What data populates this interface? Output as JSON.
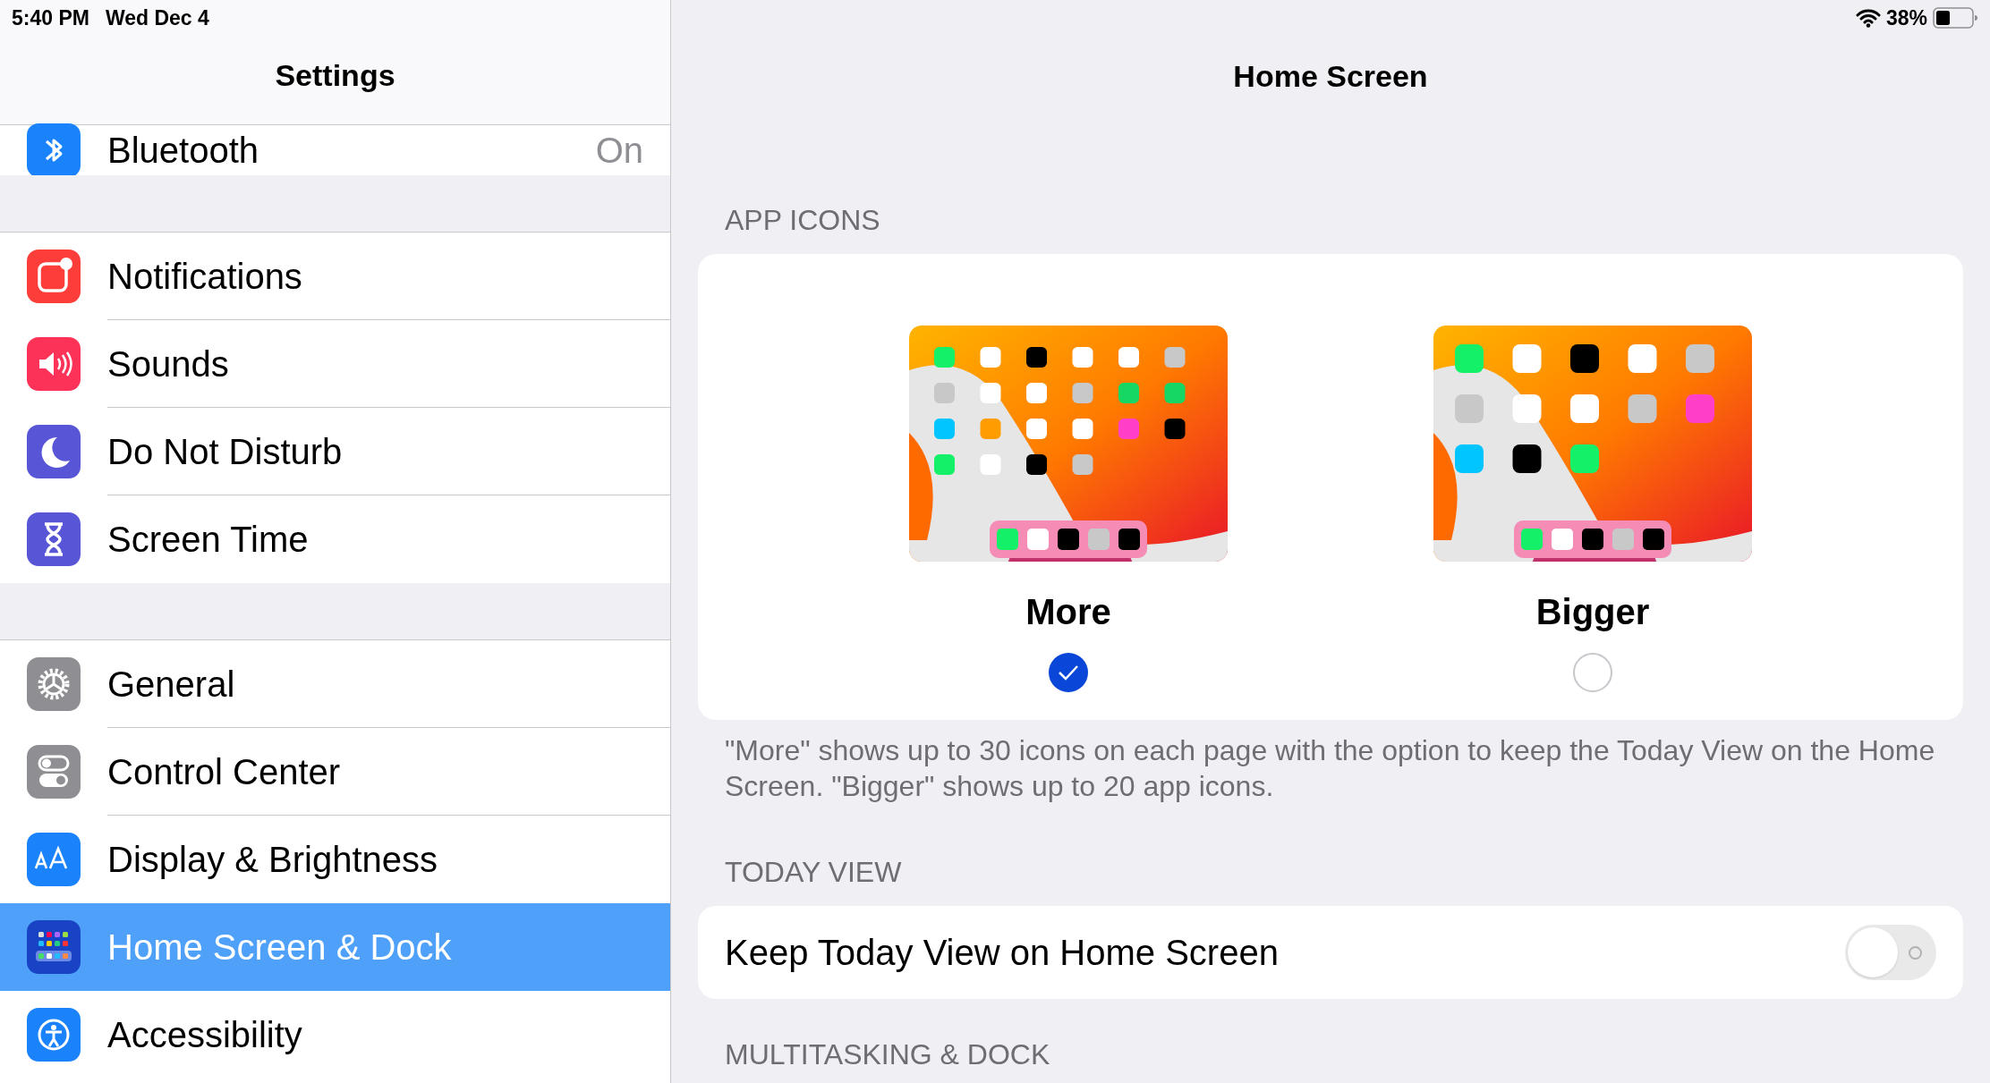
{
  "status_bar": {
    "time": "5:40 PM",
    "date": "Wed Dec 4",
    "battery": "38%"
  },
  "sidebar": {
    "title": "Settings",
    "groups": [
      [
        {
          "label": "Bluetooth",
          "value": "On",
          "selected": false
        }
      ],
      [
        {
          "label": "Notifications",
          "selected": false
        },
        {
          "label": "Sounds",
          "selected": false
        },
        {
          "label": "Do Not Disturb",
          "selected": false
        },
        {
          "label": "Screen Time",
          "selected": false
        }
      ],
      [
        {
          "label": "General",
          "selected": false
        },
        {
          "label": "Control Center",
          "selected": false
        },
        {
          "label": "Display & Brightness",
          "selected": false
        },
        {
          "label": "Home Screen & Dock",
          "selected": true
        },
        {
          "label": "Accessibility",
          "selected": false
        }
      ]
    ]
  },
  "detail": {
    "title": "Home Screen",
    "app_icons": {
      "header": "APP ICONS",
      "options": [
        {
          "label": "More",
          "selected": true
        },
        {
          "label": "Bigger",
          "selected": false
        }
      ],
      "footer": "\"More\" shows up to 30 icons on each page with the option to keep the Today View on the Home Screen. \"Bigger\" shows up to 20 app icons."
    },
    "today_view": {
      "header": "TODAY VIEW",
      "label": "Keep Today View on Home Screen",
      "on": false
    },
    "next_header": "MULTITASKING & DOCK"
  }
}
